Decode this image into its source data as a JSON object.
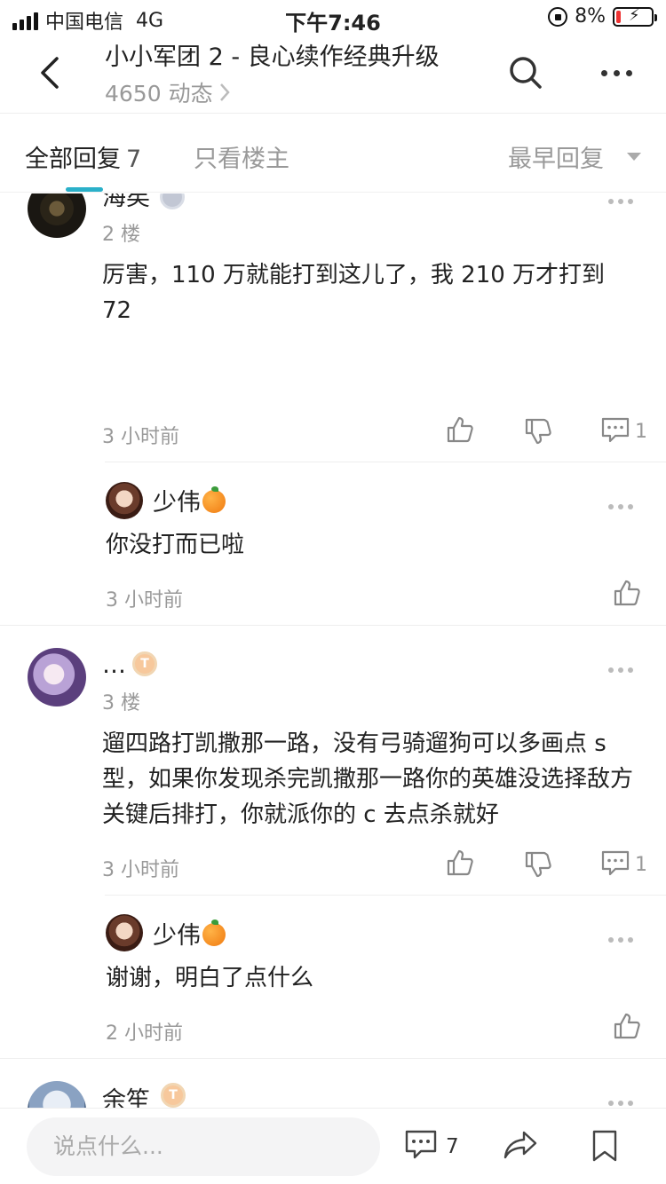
{
  "status": {
    "carrier": "中国电信",
    "network": "4G",
    "time": "下午7:46",
    "battery": "8%"
  },
  "header": {
    "title": "小小军团 2 - 良心续作经典升级",
    "subtitle": "4650 动态"
  },
  "tabs": {
    "all_label": "全部回复",
    "all_count": "7",
    "op_only": "只看楼主",
    "sort_label": "最早回复"
  },
  "comments": {
    "c1": {
      "name": "海矣",
      "floor": "2 楼",
      "text": "厉害，110 万就能打到这儿了，我 210 万才打到 72",
      "time": "3 小时前",
      "reply_count": "1",
      "reply": {
        "name": "少伟",
        "text": "你没打而已啦",
        "time": "3 小时前"
      }
    },
    "c2": {
      "name": "…",
      "floor": "3 楼",
      "text": "遛四路打凯撒那一路，没有弓骑遛狗可以多画点 s 型，如果你发现杀完凯撒那一路你的英雄没选择敌方关键后排打，你就派你的 c 去点杀就好",
      "time": "3 小时前",
      "reply_count": "1",
      "reply": {
        "name": "少伟",
        "text": "谢谢，明白了点什么",
        "time": "2 小时前"
      }
    },
    "c3": {
      "name": "余笙"
    }
  },
  "bottom": {
    "input_placeholder": "说点什么...",
    "comment_count": "7"
  },
  "colors": {
    "accent": "#2ab0c9",
    "muted": "#999999",
    "badge": "#f7c89c"
  }
}
